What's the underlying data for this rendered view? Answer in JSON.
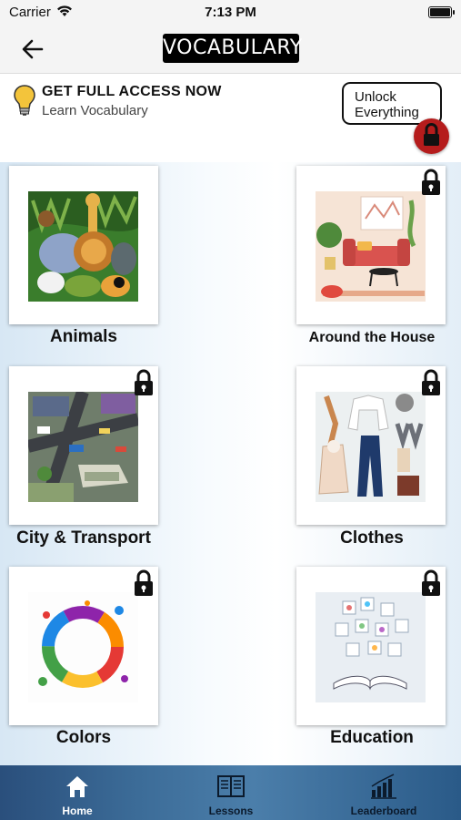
{
  "status_bar": {
    "carrier": "Carrier",
    "time": "7:13 PM"
  },
  "nav": {
    "title": "VOCABULARY"
  },
  "promo": {
    "title": "GET FULL ACCESS NOW",
    "subtitle": "Learn Vocabulary",
    "unlock_line1": "Unlock",
    "unlock_line2": "Everything"
  },
  "categories": [
    {
      "label": "Animals",
      "locked": false
    },
    {
      "label": "Around the House",
      "locked": true
    },
    {
      "label": "City & Transport",
      "locked": true
    },
    {
      "label": "Clothes",
      "locked": true
    },
    {
      "label": "Colors",
      "locked": true
    },
    {
      "label": "Education",
      "locked": true
    }
  ],
  "tabs": [
    {
      "label": "Home",
      "active": true
    },
    {
      "label": "Lessons",
      "active": false
    },
    {
      "label": "Leaderboard",
      "active": false
    }
  ],
  "colors": {
    "tabbar": "#3c6c98",
    "active_tab_label": "#ffffff",
    "inactive_tab_label": "#0b1a2c",
    "lock_badge": "#b51c1c"
  }
}
